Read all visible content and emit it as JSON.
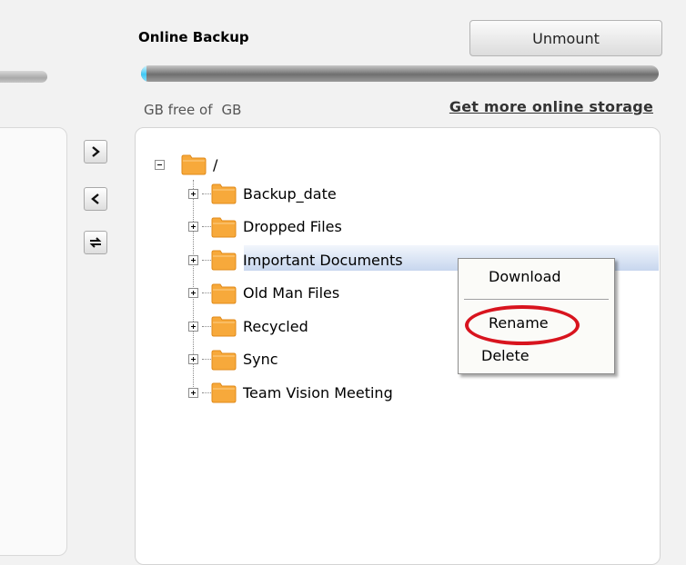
{
  "header": {
    "title": "Online Backup",
    "unmount_label": "Unmount",
    "progress_fraction": 0.01
  },
  "storage": {
    "free_text": "GB free of",
    "total_text": "GB",
    "get_more_link": "Get more online storage"
  },
  "transfer_buttons": [
    {
      "name": "upload",
      "icon": "arrow-right-icon"
    },
    {
      "name": "download",
      "icon": "arrow-left-icon"
    },
    {
      "name": "sync",
      "icon": "sync-arrows-icon"
    }
  ],
  "tree": {
    "root": "/",
    "folders": [
      "Backup_date",
      "Dropped Files",
      "Important Documents",
      "Old Man Files",
      "Recycled",
      "Sync",
      "Team Vision Meeting"
    ],
    "selected": "Important Documents"
  },
  "context_menu": {
    "items": [
      "Download",
      "Rename",
      "Delete"
    ],
    "highlighted": "Rename"
  },
  "colors": {
    "folder": "#f7a93b",
    "progress_fill": "#3fc8f5",
    "highlight_ring": "#d8141e"
  }
}
